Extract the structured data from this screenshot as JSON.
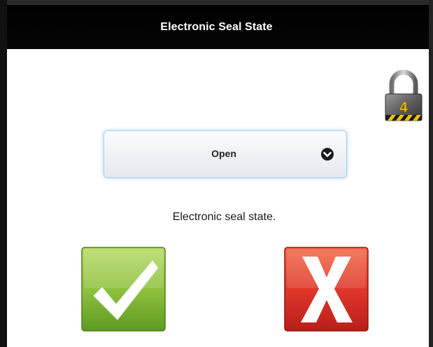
{
  "dialog": {
    "title": "Electronic Seal State",
    "lock_badge_number": "4",
    "select": {
      "selected_value": "Open"
    },
    "caption": "Electronic seal state.",
    "icons": {
      "lock": "padlock-icon",
      "chevron": "chevron-down-icon",
      "confirm": "checkmark-icon",
      "cancel": "x-icon"
    },
    "colors": {
      "header_bg": "#000000",
      "confirm_green": "#8dc63f",
      "cancel_red": "#e03a2a",
      "select_border": "#a9cfe9"
    }
  }
}
